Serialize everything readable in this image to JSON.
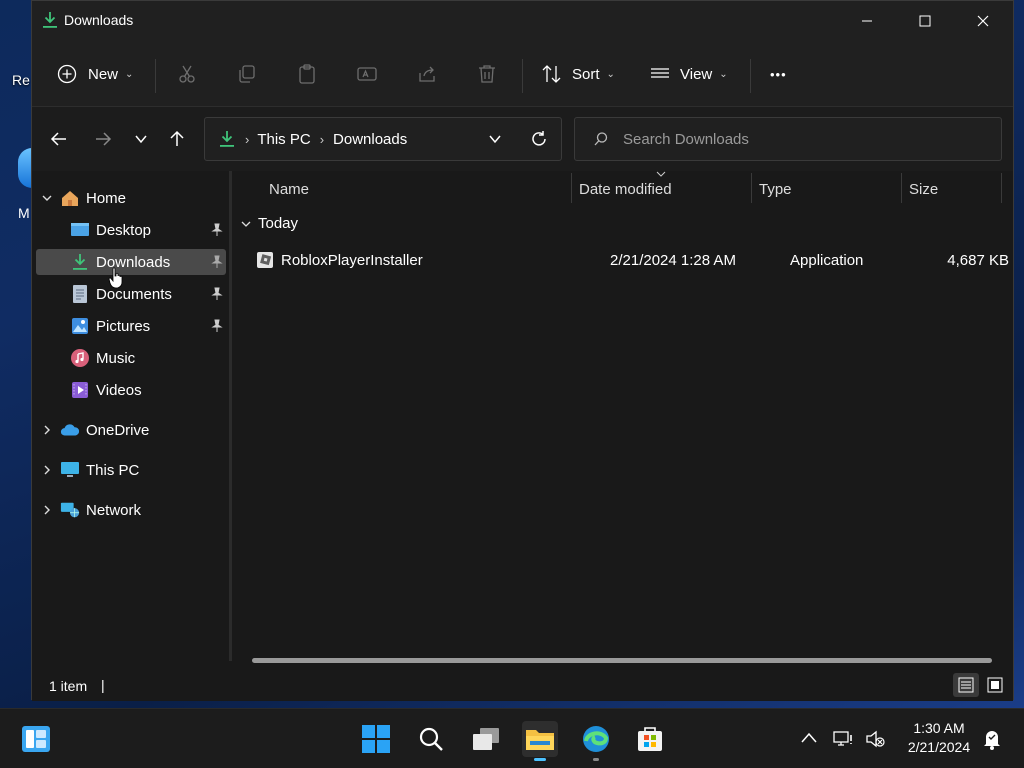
{
  "desktop": {
    "partial_label_top": "Re",
    "partial_label_bottom": "M"
  },
  "window": {
    "title": "Downloads",
    "controls": {
      "minimize": "—",
      "maximize": "☐",
      "close": "✕"
    }
  },
  "commandbar": {
    "new_label": "New",
    "sort_label": "Sort",
    "view_label": "View",
    "more_label": "•••"
  },
  "address": {
    "segments": [
      "This PC",
      "Downloads"
    ],
    "search_placeholder": "Search Downloads"
  },
  "sidebar": {
    "home": "Home",
    "pinned": [
      {
        "label": "Desktop"
      },
      {
        "label": "Downloads"
      },
      {
        "label": "Documents"
      },
      {
        "label": "Pictures"
      },
      {
        "label": "Music"
      },
      {
        "label": "Videos"
      }
    ],
    "onedrive": "OneDrive",
    "thispc": "This PC",
    "network": "Network"
  },
  "columns": {
    "name": "Name",
    "date": "Date modified",
    "type": "Type",
    "size": "Size"
  },
  "groups": [
    {
      "label": "Today",
      "files": [
        {
          "name": "RobloxPlayerInstaller",
          "date": "2/21/2024 1:28 AM",
          "type": "Application",
          "size": "4,687 KB"
        }
      ]
    }
  ],
  "status": {
    "count": "1 item",
    "cursor_bar": "|"
  },
  "taskbar": {
    "time": "1:30 AM",
    "date": "2/21/2024"
  },
  "colors": {
    "accent": "#4cc2ff",
    "download_green": "#3fc47a",
    "selection": "#4a4a4a"
  }
}
